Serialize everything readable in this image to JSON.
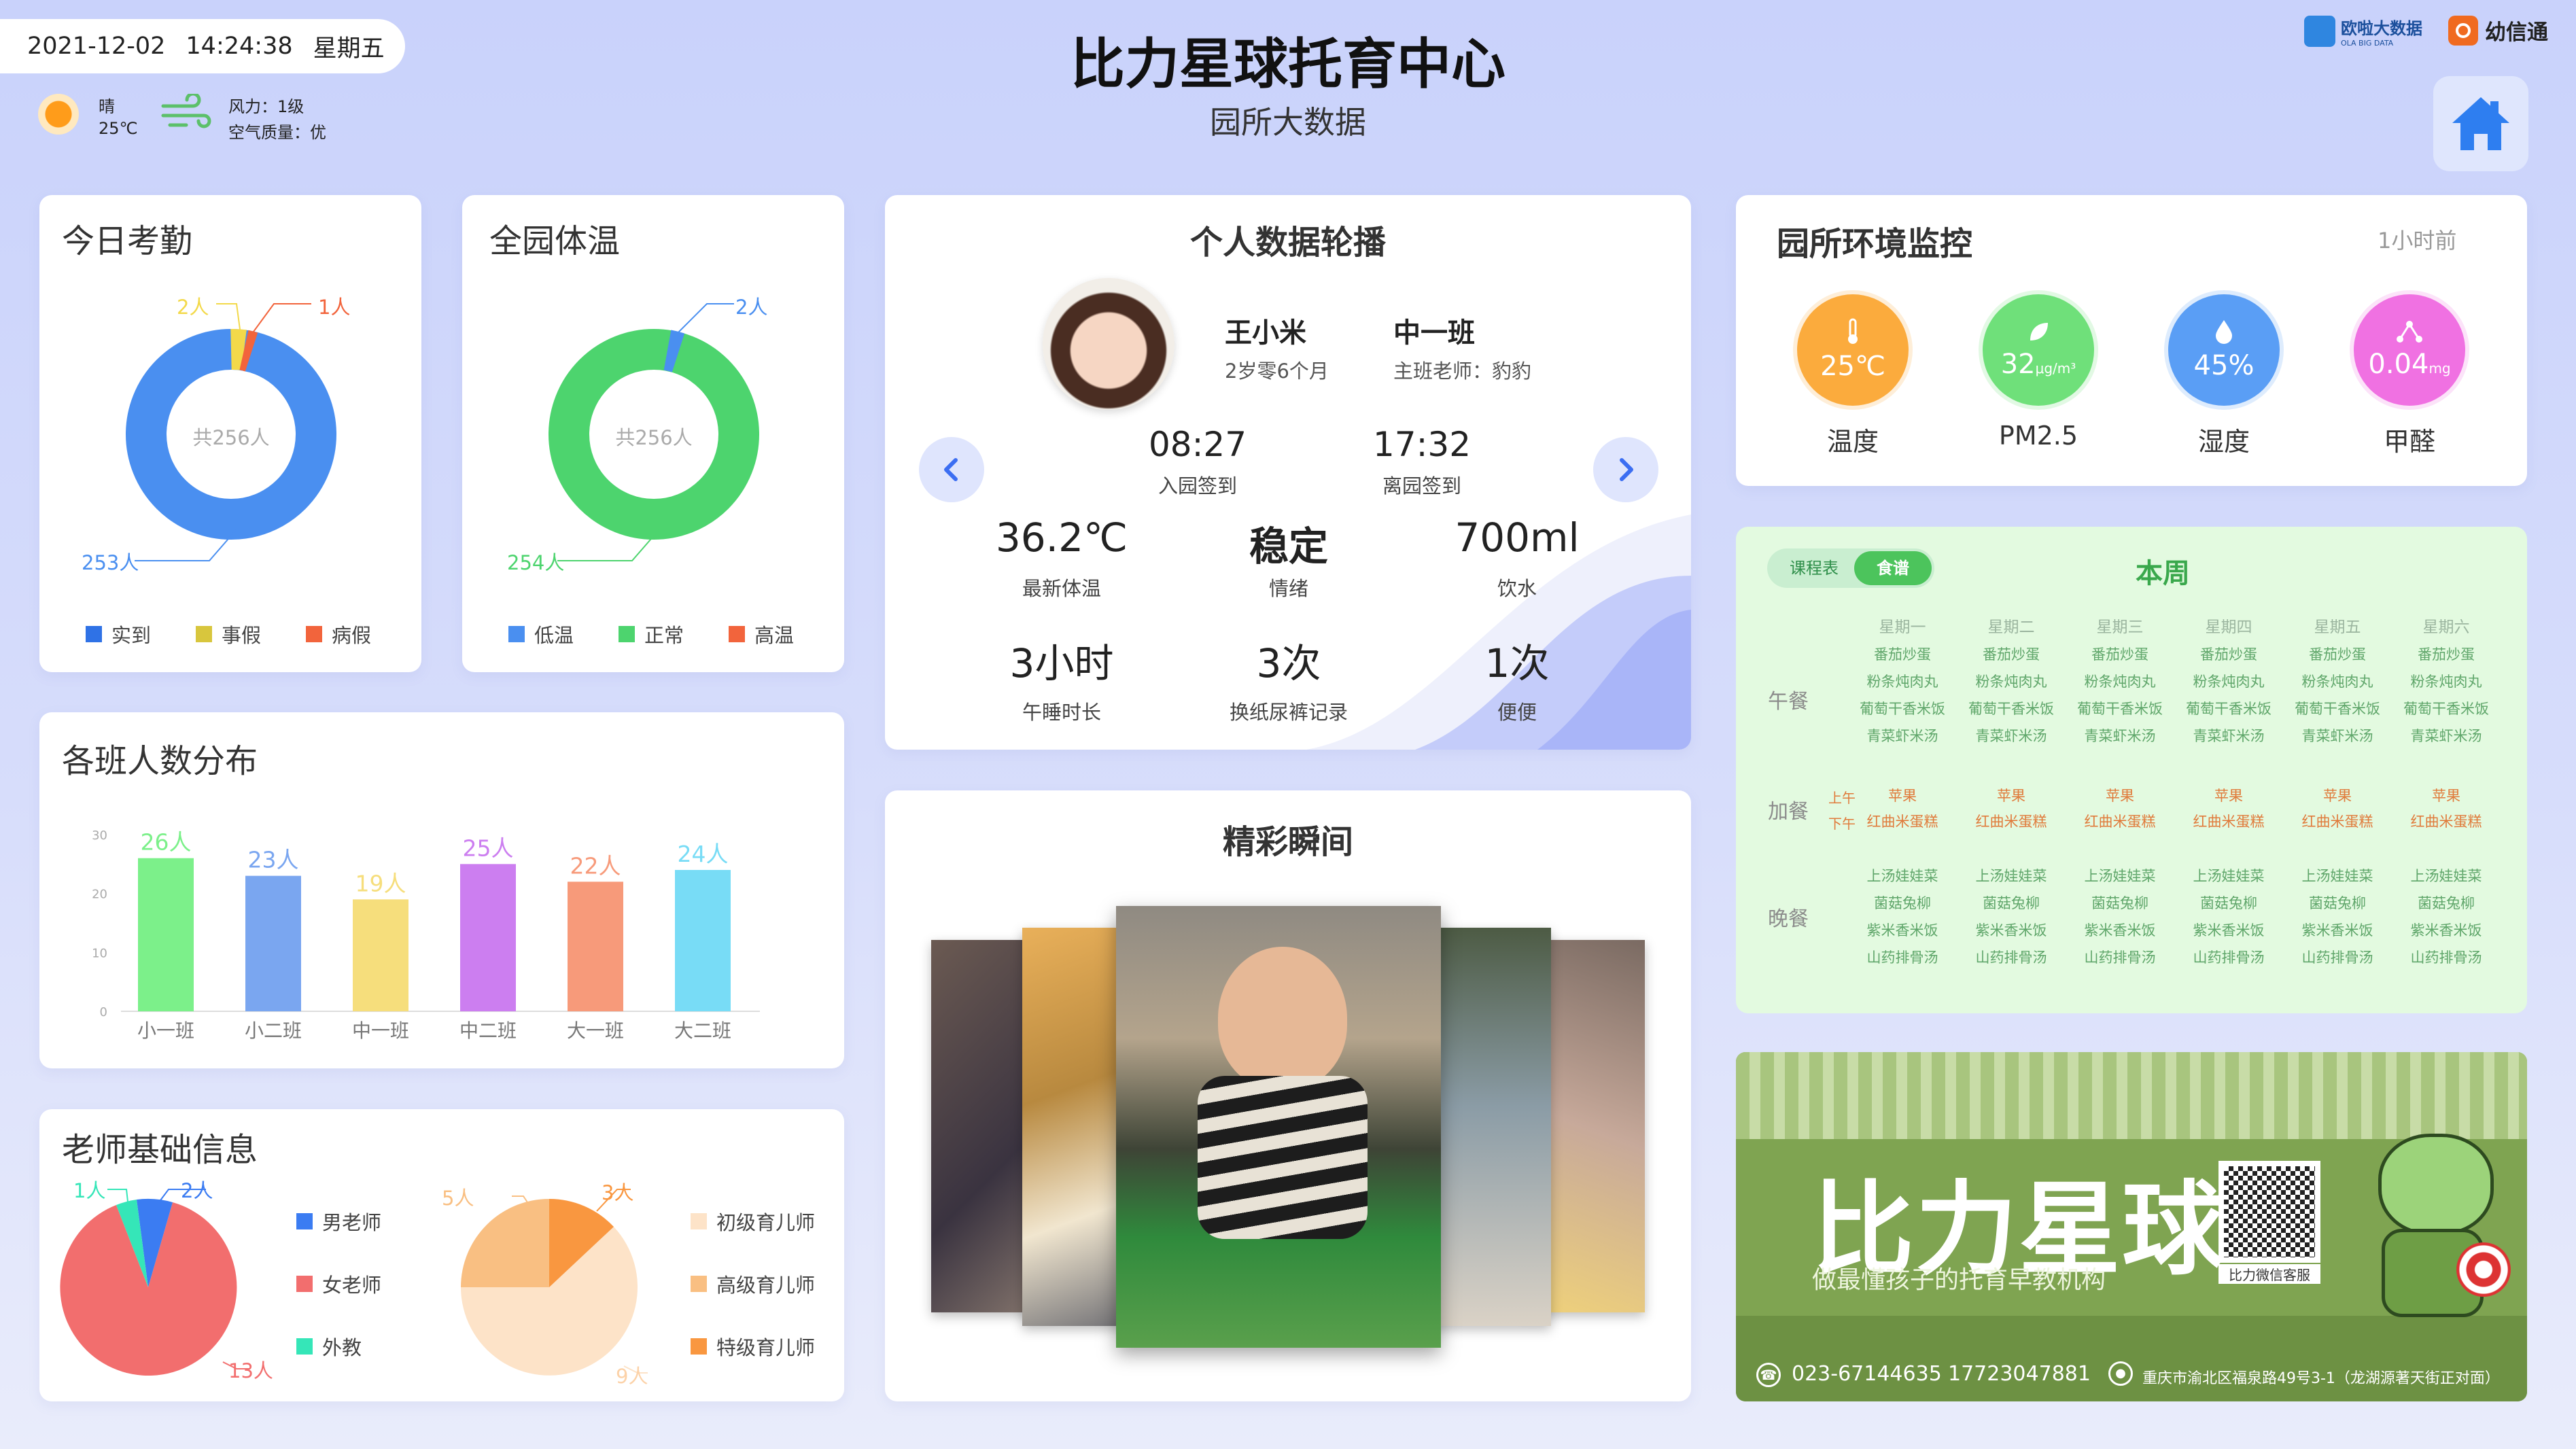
{
  "header": {
    "date": "2021-12-02",
    "time": "14:24:38",
    "weekday": "星期五",
    "weather": "晴",
    "temp": "25℃",
    "wind": "风力：1级",
    "air": "空气质量：优",
    "title": "比力星球托育中心",
    "subtitle": "园所大数据",
    "logo1_main": "欧啦大数据",
    "logo1_sub": "OLA BIG DATA",
    "logo2": "幼信通"
  },
  "attendance": {
    "title": "今日考勤",
    "center": "共256人",
    "labels": {
      "a": "253人",
      "b": "2人",
      "c": "1人"
    },
    "legend": [
      "实到",
      "事假",
      "病假"
    ],
    "colors": [
      "#4a8ff0",
      "#f3d94a",
      "#f2643c"
    ],
    "values": [
      253,
      2,
      1
    ]
  },
  "temperature": {
    "title": "全园体温",
    "center": "共256人",
    "labels": {
      "a": "254人",
      "b": "2人"
    },
    "legend": [
      "低温",
      "正常",
      "高温"
    ],
    "colors": [
      "#4a8ff0",
      "#4dd46e",
      "#f2643c"
    ],
    "values": [
      2,
      254,
      0
    ]
  },
  "class_dist": {
    "title": "各班人数分布",
    "chart_data": {
      "type": "bar",
      "categories": [
        "小一班",
        "小二班",
        "中一班",
        "中二班",
        "大一班",
        "大二班"
      ],
      "values": [
        26,
        23,
        19,
        25,
        22,
        24
      ],
      "ylim": [
        0,
        30
      ],
      "yticks": [
        "30",
        "20",
        "10",
        "0"
      ],
      "colors": [
        "#7cf08a",
        "#7aa6f0",
        "#f6de7c",
        "#cc7ef0",
        "#f79a7a",
        "#78dcf6"
      ]
    }
  },
  "teachers": {
    "title": "老师基础信息",
    "gender": {
      "labels": {
        "a": "1人",
        "b": "2人",
        "c": "13人"
      },
      "legend": [
        "男老师",
        "女老师",
        "外教"
      ],
      "colors": [
        "#3b7cf2",
        "#f26e6e",
        "#35e6b8"
      ],
      "values": [
        2,
        13,
        1
      ]
    },
    "level": {
      "labels": {
        "a": "5人",
        "b": "3人",
        "c": "9人"
      },
      "legend": [
        "初级育儿师",
        "高级育儿师",
        "特级育儿师"
      ],
      "colors": [
        "#fde3c8",
        "#f9bf82",
        "#f99740"
      ],
      "values": [
        9,
        5,
        3
      ]
    }
  },
  "personal": {
    "title": "个人数据轮播",
    "name": "王小米",
    "age": "2岁零6个月",
    "cls": "中一班",
    "teacher": "主班老师：豹豹",
    "in_time": "08:27",
    "in_label": "入园签到",
    "out_time": "17:32",
    "out_label": "离园签到",
    "stats": [
      {
        "v": "36.2℃",
        "l": "最新体温"
      },
      {
        "v": "稳定",
        "l": "情绪"
      },
      {
        "v": "700ml",
        "l": "饮水"
      },
      {
        "v": "3小时",
        "l": "午睡时长"
      },
      {
        "v": "3次",
        "l": "换纸尿裤记录"
      },
      {
        "v": "1次",
        "l": "便便"
      }
    ]
  },
  "moments": {
    "title": "精彩瞬间"
  },
  "env": {
    "title": "园所环境监控",
    "ago": "1小时前",
    "items": [
      {
        "v": "25℃",
        "u": "",
        "l": "温度",
        "c": "#fbab3d",
        "icon": "thermometer-icon"
      },
      {
        "v": "32",
        "u": "μg/m³",
        "l": "PM2.5",
        "c": "#6fe07a",
        "icon": "leaf-icon"
      },
      {
        "v": "45%",
        "u": "",
        "l": "湿度",
        "c": "#5a9ef5",
        "icon": "drop-icon"
      },
      {
        "v": "0.04",
        "u": "mg",
        "l": "甲醛",
        "c": "#f071e2",
        "icon": "molecule-icon"
      }
    ]
  },
  "menu": {
    "tab1": "课程表",
    "tab2": "食谱",
    "week": "本周",
    "days": [
      "星期一",
      "星期二",
      "星期三",
      "星期四",
      "星期五",
      "星期六"
    ],
    "lunch_label": "午餐",
    "snack_label": "加餐",
    "dinner_label": "晚餐",
    "am": "上午",
    "pm": "下午",
    "lunch": [
      "番茄炒蛋",
      "粉条炖肉丸",
      "葡萄干香米饭",
      "青菜虾米汤"
    ],
    "snack_am": "苹果",
    "snack_pm": "红曲米蛋糕",
    "dinner": [
      "上汤娃娃菜",
      "菌菇兔柳",
      "紫米香米饭",
      "山药排骨汤"
    ]
  },
  "banner": {
    "big": "比力星球",
    "slogan": "做最懂孩子的托育早教机构",
    "qr_caption": "比力微信客服",
    "phone": "023-67144635",
    "mobile": "17723047881",
    "address": "重庆市渝北区福泉路49号3-1（龙湖源著天街正对面）"
  }
}
